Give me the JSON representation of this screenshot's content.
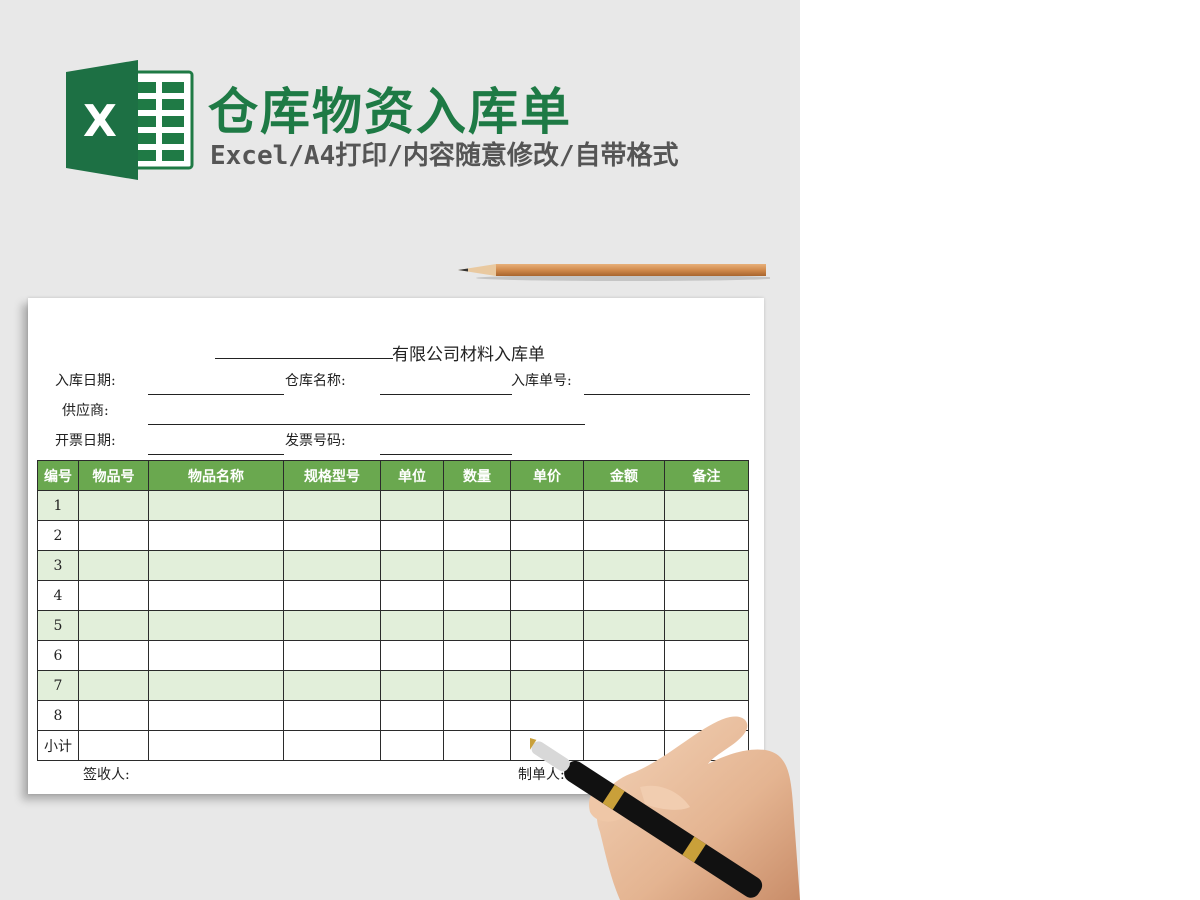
{
  "header": {
    "logo_letter": "X",
    "title": "仓库物资入库单",
    "subtitle": "Excel/A4打印/内容随意修改/自带格式"
  },
  "form": {
    "doc_title": "有限公司材料入库单",
    "fields": {
      "in_date": "入库日期:",
      "warehouse": "仓库名称:",
      "in_no": "入库单号:",
      "supplier": "供应商:",
      "invoice_date": "开票日期:",
      "invoice_no": "发票号码:"
    },
    "table": {
      "headers": [
        "编号",
        "物品号",
        "物品名称",
        "规格型号",
        "单位",
        "数量",
        "单价",
        "金额",
        "备注"
      ],
      "row_labels": [
        "1",
        "2",
        "3",
        "4",
        "5",
        "6",
        "7",
        "8",
        "小计"
      ]
    },
    "footer": {
      "receiver": "签收人:",
      "maker": "制单人:"
    }
  },
  "colors": {
    "brand_green": "#1e7a45",
    "header_green": "#6aa84f",
    "row_alt": "#e2efda"
  }
}
